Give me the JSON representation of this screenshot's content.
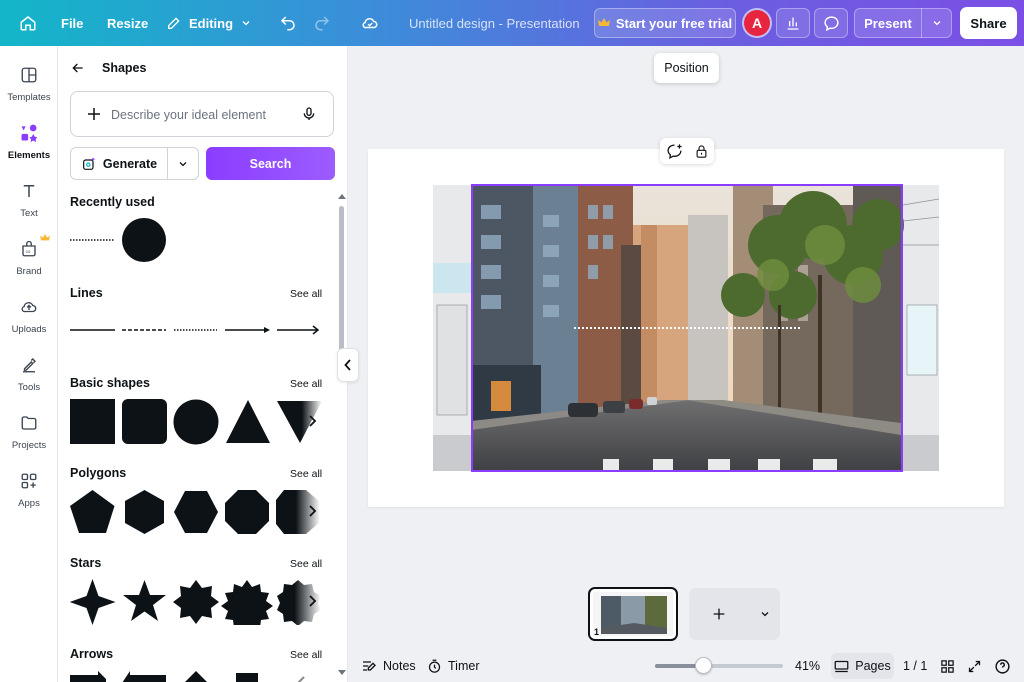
{
  "topbar": {
    "file_label": "File",
    "resize_label": "Resize",
    "editing_label": "Editing",
    "doc_title": "Untitled design - Presentation",
    "trial_label": "Start your free trial",
    "avatar_initial": "A",
    "present_label": "Present",
    "share_label": "Share",
    "accent": "#8b3dff"
  },
  "rail": {
    "items": [
      {
        "label": "Templates",
        "icon": "templates-icon"
      },
      {
        "label": "Elements",
        "icon": "elements-icon",
        "active": true
      },
      {
        "label": "Text",
        "icon": "text-icon"
      },
      {
        "label": "Brand",
        "icon": "brand-icon"
      },
      {
        "label": "Uploads",
        "icon": "uploads-icon"
      },
      {
        "label": "Tools",
        "icon": "tools-icon"
      },
      {
        "label": "Projects",
        "icon": "projects-icon"
      },
      {
        "label": "Apps",
        "icon": "apps-icon"
      }
    ]
  },
  "panel": {
    "title": "Shapes",
    "search_placeholder": "Describe your ideal element",
    "generate_label": "Generate",
    "search_label": "Search",
    "sections": {
      "recent": "Recently used",
      "lines": "Lines",
      "basic": "Basic shapes",
      "polygons": "Polygons",
      "stars": "Stars",
      "arrows": "Arrows"
    },
    "see_all": "See all"
  },
  "canvas": {
    "tooltip": "Position",
    "page_number": "1",
    "selection_color": "#8b3dff"
  },
  "bottombar": {
    "notes_label": "Notes",
    "timer_label": "Timer",
    "zoom_label": "41%",
    "zoom_fraction": 0.41,
    "pages_label": "Pages",
    "page_count": "1 / 1"
  }
}
